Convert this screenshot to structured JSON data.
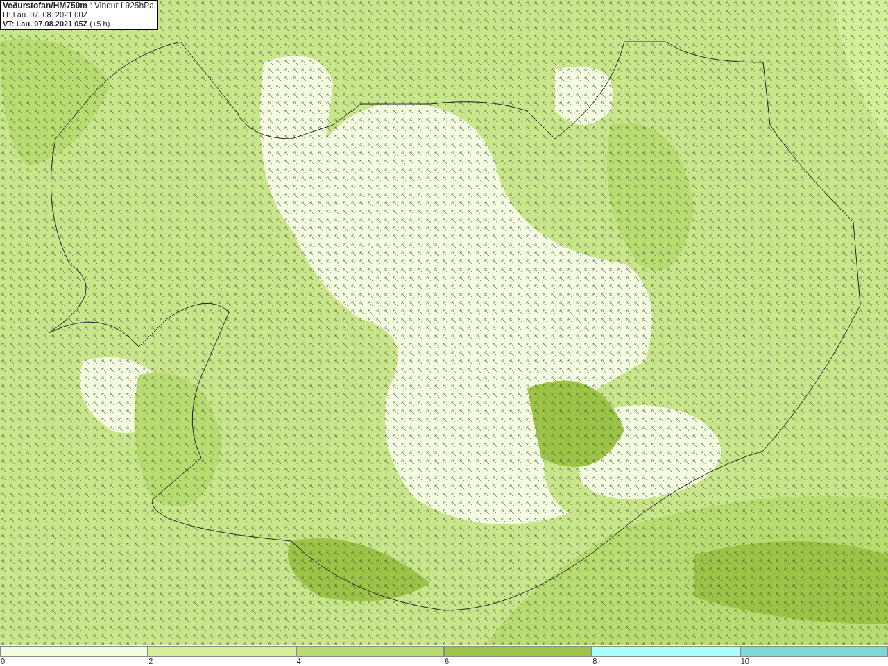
{
  "title_box": {
    "lines": [
      "**Veðurstofan/HM750m** : Vindur í 925hPa",
      "IT: Lau. 07. 08. 2021 00Z",
      "**VT: Lau. 07.08.2021 05Z** (+5 h)"
    ]
  },
  "legend": {
    "bins": [
      {
        "color": "#f5fde0"
      },
      {
        "color": "#d6f09a"
      },
      {
        "color": "#b8dc70"
      },
      {
        "color": "#9cc446"
      },
      {
        "color": "#aaffff"
      },
      {
        "color": "#7fd8d8"
      }
    ],
    "ticks": [
      "0",
      "2",
      "4",
      "6",
      "8",
      "10"
    ]
  }
}
